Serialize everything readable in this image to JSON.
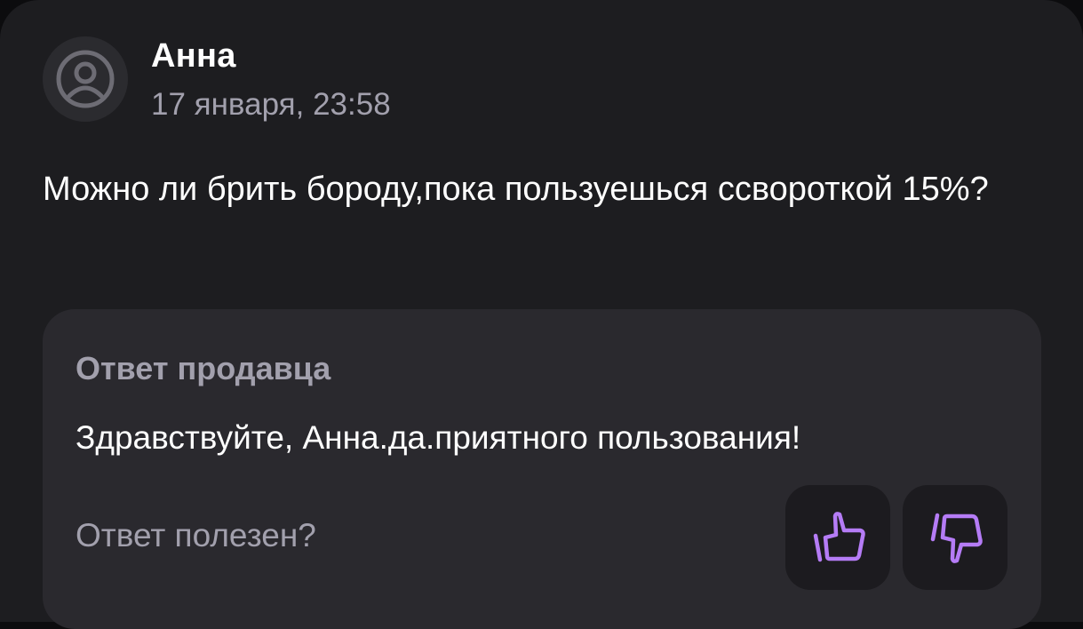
{
  "review": {
    "author": "Анна",
    "date": "17 января, 23:58",
    "text": "Можно ли брить бороду,пока пользуешься ссвороткой 15%?"
  },
  "seller_answer": {
    "title": "Ответ продавца",
    "text": "Здравствуйте, Анна.да.приятного пользования!"
  },
  "feedback": {
    "question": "Ответ полезен?",
    "like_icon": "thumbs-up-icon",
    "dislike_icon": "thumbs-down-icon"
  },
  "colors": {
    "accent": "#b57cf6",
    "background": "#1d1d20",
    "answer_background": "#2a292e",
    "muted_text": "#a2a0ad"
  }
}
